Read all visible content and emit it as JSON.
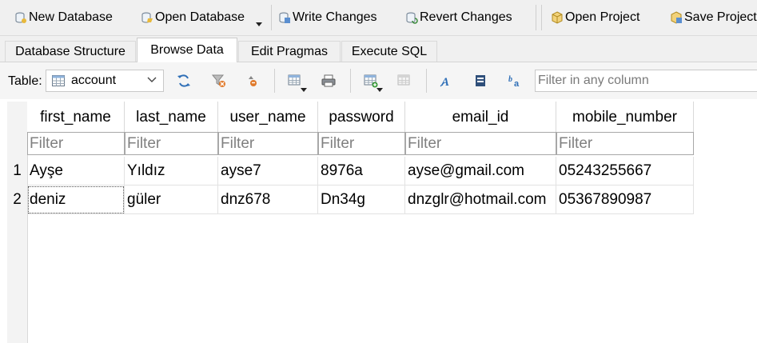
{
  "toolbar": {
    "new_database": "New Database",
    "open_database": "Open Database",
    "write_changes": "Write Changes",
    "revert_changes": "Revert Changes",
    "open_project": "Open Project",
    "save_project": "Save Project"
  },
  "tabs": [
    {
      "label": "Database Structure",
      "active": false
    },
    {
      "label": "Browse Data",
      "active": true
    },
    {
      "label": "Edit Pragmas",
      "active": false
    },
    {
      "label": "Execute SQL",
      "active": false
    }
  ],
  "browse": {
    "table_label": "Table:",
    "table_value": "account",
    "filter_any_placeholder": "Filter in any column"
  },
  "grid": {
    "columns": [
      "first_name",
      "last_name",
      "user_name",
      "password",
      "email_id",
      "mobile_number"
    ],
    "filter_placeholder": "Filter",
    "row_numbers": [
      "1",
      "2"
    ],
    "rows": [
      [
        "Ayşe",
        "Yıldız",
        "ayse7",
        "8976a",
        "ayse@gmail.com",
        "05243255667"
      ],
      [
        "deniz",
        "güler",
        "dnz678",
        "Dn34g",
        "dnzglr@hotmail.com",
        "05367890987"
      ]
    ]
  },
  "icons": {
    "new_database": "new-database-icon",
    "open_database": "open-database-icon",
    "write_changes": "write-changes-icon",
    "revert_changes": "revert-changes-icon",
    "open_project": "open-project-icon",
    "save_project": "save-project-icon",
    "refresh": "refresh-icon",
    "clear_filters": "clear-filters-icon",
    "sort": "sort-icon",
    "save_table": "save-table-icon",
    "print": "print-icon",
    "insert_record": "insert-record-icon",
    "delete_record": "delete-record-icon",
    "find": "find-icon",
    "find_replace": "find-replace-icon",
    "text_format": "text-format-icon"
  },
  "colors": {
    "toolbar_bg": "#f0f0f0",
    "grid_border": "#d9d9d9",
    "filter_border": "#a8a8a8",
    "icon_blue": "#2f6fb7",
    "icon_yellow": "#e8b93c"
  }
}
